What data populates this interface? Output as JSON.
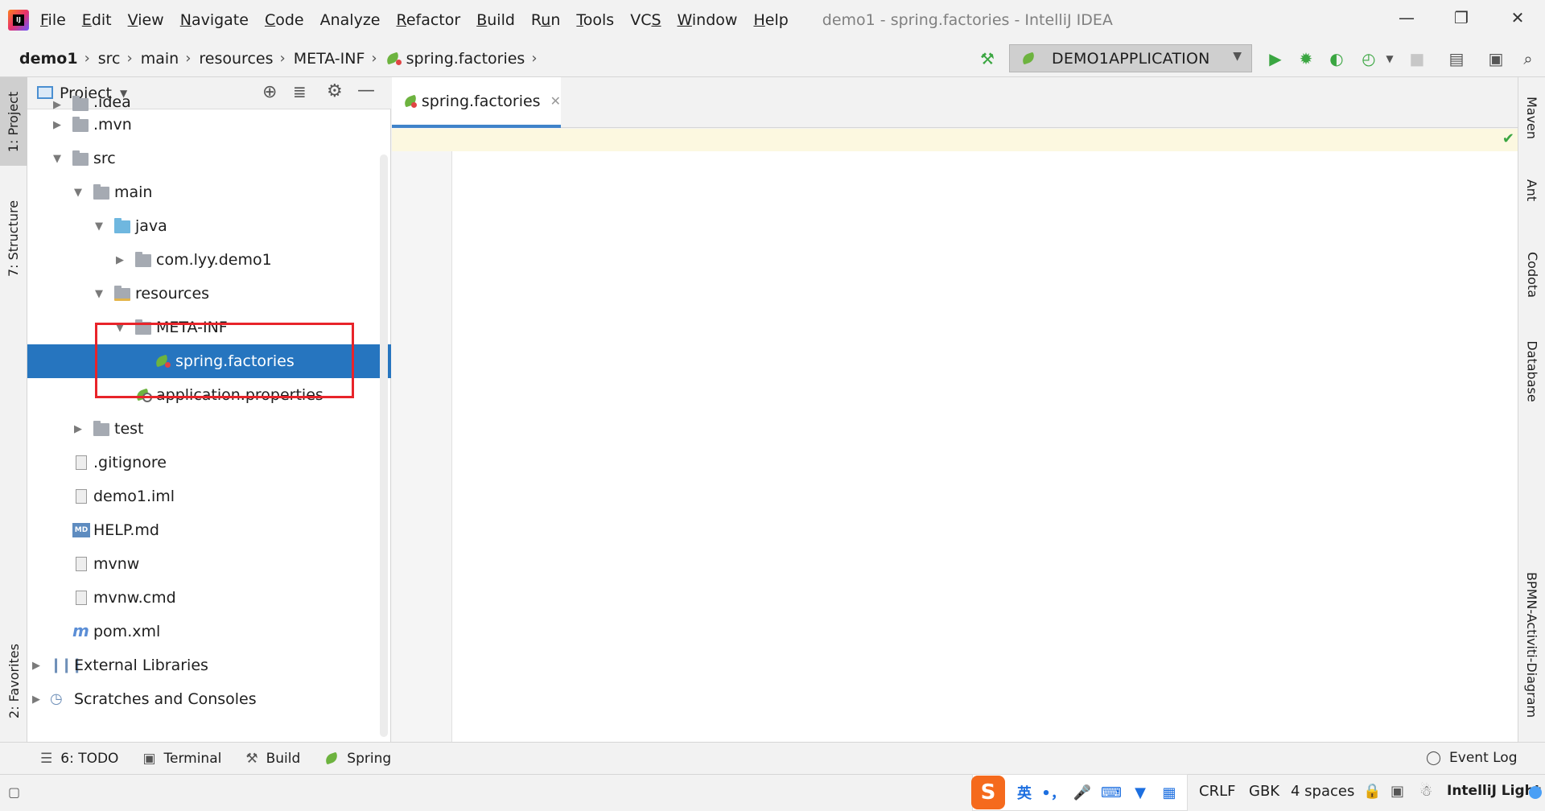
{
  "window": {
    "title": "demo1 - spring.factories - IntelliJ IDEA",
    "logo": "IJ",
    "controls": [
      "minimize",
      "restore",
      "close"
    ]
  },
  "menu": {
    "items": [
      {
        "label": "File",
        "mnemonic": "F"
      },
      {
        "label": "Edit",
        "mnemonic": "E"
      },
      {
        "label": "View",
        "mnemonic": "V"
      },
      {
        "label": "Navigate",
        "mnemonic": "N"
      },
      {
        "label": "Code",
        "mnemonic": "C"
      },
      {
        "label": "Analyze"
      },
      {
        "label": "Refactor",
        "mnemonic": "R"
      },
      {
        "label": "Build",
        "mnemonic": "B"
      },
      {
        "label": "Run",
        "mnemonic": "u"
      },
      {
        "label": "Tools",
        "mnemonic": "T"
      },
      {
        "label": "VCS",
        "mnemonic": "S"
      },
      {
        "label": "Window",
        "mnemonic": "W"
      },
      {
        "label": "Help",
        "mnemonic": "H"
      }
    ]
  },
  "breadcrumb": [
    "demo1",
    "src",
    "main",
    "resources",
    "META-INF",
    "spring.factories"
  ],
  "toolbar": {
    "run_config": "DEMO1APPLICATION",
    "icons": [
      "build-hammer-icon",
      "run-icon",
      "debug-icon",
      "coverage-icon",
      "profile-icon",
      "stop-icon",
      "project-structure-icon",
      "layout-icon",
      "search-everywhere-icon"
    ]
  },
  "left_tabs": {
    "project": "1: Project",
    "structure": "7: Structure",
    "favorites": "2: Favorites"
  },
  "right_tabs": {
    "maven": "Maven",
    "ant": "Ant",
    "codota": "Codota",
    "database": "Database",
    "bpmn": "BPMN-Activiti-Diagram"
  },
  "project_panel": {
    "title": "Project",
    "tree": [
      {
        "label": ".idea",
        "kind": "folder",
        "depth": 1,
        "expanded": false
      },
      {
        "label": ".mvn",
        "kind": "folder",
        "depth": 1,
        "expanded": false
      },
      {
        "label": "src",
        "kind": "folder",
        "depth": 1,
        "expanded": true
      },
      {
        "label": "main",
        "kind": "folder",
        "depth": 2,
        "expanded": true
      },
      {
        "label": "java",
        "kind": "source-folder",
        "depth": 3,
        "expanded": true
      },
      {
        "label": "com.lyy.demo1",
        "kind": "package",
        "depth": 4,
        "expanded": false
      },
      {
        "label": "resources",
        "kind": "resources-folder",
        "depth": 3,
        "expanded": true
      },
      {
        "label": "META-INF",
        "kind": "folder",
        "depth": 4,
        "expanded": true
      },
      {
        "label": "spring.factories",
        "kind": "spring-file",
        "depth": 5,
        "selected": true
      },
      {
        "label": "application.properties",
        "kind": "spring-config",
        "depth": 4
      },
      {
        "label": "test",
        "kind": "folder",
        "depth": 2,
        "expanded": false
      },
      {
        "label": ".gitignore",
        "kind": "file",
        "depth": 1
      },
      {
        "label": "demo1.iml",
        "kind": "file",
        "depth": 1
      },
      {
        "label": "HELP.md",
        "kind": "markdown",
        "depth": 1
      },
      {
        "label": "mvnw",
        "kind": "file",
        "depth": 1
      },
      {
        "label": "mvnw.cmd",
        "kind": "file",
        "depth": 1
      },
      {
        "label": "pom.xml",
        "kind": "maven",
        "depth": 1
      },
      {
        "label": "External Libraries",
        "kind": "libraries",
        "depth": 0,
        "expanded": false
      },
      {
        "label": "Scratches and Consoles",
        "kind": "scratches",
        "depth": 0,
        "expanded": false
      }
    ]
  },
  "editor": {
    "tab_label": "spring.factories",
    "content": ""
  },
  "bottom_tools": [
    {
      "label": "6: TODO",
      "icon": "list-icon"
    },
    {
      "label": "Terminal",
      "icon": "terminal-icon"
    },
    {
      "label": "Build",
      "icon": "hammer-icon"
    },
    {
      "label": "Spring",
      "icon": "spring-leaf-icon"
    }
  ],
  "event_log": "Event Log",
  "status": {
    "line_sep": "CRLF",
    "encoding": "GBK",
    "indent": "4 spaces",
    "theme": "IntelliJ Light"
  },
  "ime": {
    "lang": "英",
    "punct": "•，"
  },
  "colors": {
    "selection": "#2675bf",
    "highlight_box": "#e8242a",
    "spring_green": "#6db33f",
    "run_green": "#3aa641"
  }
}
